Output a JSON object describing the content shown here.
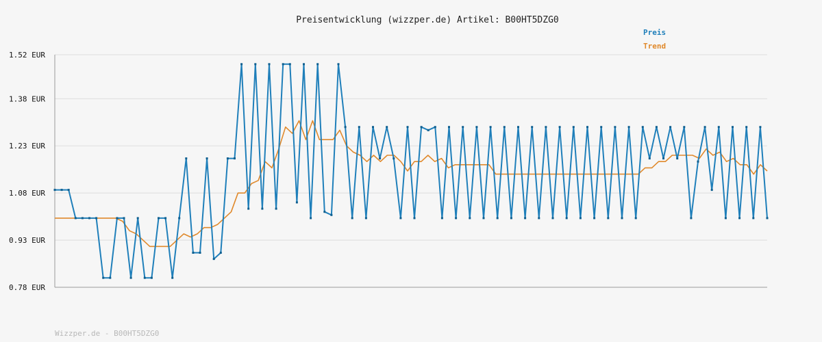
{
  "chart_data": {
    "type": "line",
    "title": "Preisentwicklung (wizzper.de) Artikel: B00HT5DZG0",
    "y_ticks": [
      "1.52 EUR",
      "1.38 EUR",
      "1.23 EUR",
      "1.08 EUR",
      "0.93 EUR",
      "0.78 EUR"
    ],
    "y_tick_values": [
      1.52,
      1.38,
      1.23,
      1.08,
      0.93,
      0.78
    ],
    "ylim": [
      0.78,
      1.52
    ],
    "grid": true,
    "legend_position": "top-right",
    "series": [
      {
        "name": "Preis",
        "color": "#1f7fba",
        "values": [
          1.09,
          1.09,
          1.09,
          1.0,
          1.0,
          1.0,
          1.0,
          0.81,
          0.81,
          1.0,
          1.0,
          0.81,
          1.0,
          0.81,
          0.81,
          1.0,
          1.0,
          0.81,
          1.0,
          1.19,
          0.89,
          0.89,
          1.19,
          0.87,
          0.89,
          1.19,
          1.19,
          1.49,
          1.03,
          1.49,
          1.03,
          1.49,
          1.03,
          1.49,
          1.49,
          1.05,
          1.49,
          1.0,
          1.49,
          1.02,
          1.01,
          1.49,
          1.29,
          1.0,
          1.29,
          1.0,
          1.29,
          1.19,
          1.29,
          1.19,
          1.0,
          1.29,
          1.0,
          1.29,
          1.28,
          1.29,
          1.0,
          1.29,
          1.0,
          1.29,
          1.0,
          1.29,
          1.0,
          1.29,
          1.0,
          1.29,
          1.0,
          1.29,
          1.0,
          1.29,
          1.0,
          1.29,
          1.0,
          1.29,
          1.0,
          1.29,
          1.0,
          1.29,
          1.0,
          1.29,
          1.0,
          1.29,
          1.0,
          1.29,
          1.0,
          1.29,
          1.19,
          1.29,
          1.19,
          1.29,
          1.19,
          1.29,
          1.0,
          1.18,
          1.29,
          1.09,
          1.29,
          1.0,
          1.29,
          1.0,
          1.29,
          1.0,
          1.29,
          1.0
        ]
      },
      {
        "name": "Trend",
        "color": "#e0892b",
        "values": [
          1.0,
          1.0,
          1.0,
          1.0,
          1.0,
          1.0,
          1.0,
          1.0,
          1.0,
          1.0,
          0.99,
          0.96,
          0.95,
          0.93,
          0.91,
          0.91,
          0.91,
          0.91,
          0.93,
          0.95,
          0.94,
          0.95,
          0.97,
          0.97,
          0.98,
          1.0,
          1.02,
          1.08,
          1.08,
          1.11,
          1.12,
          1.18,
          1.16,
          1.22,
          1.29,
          1.27,
          1.31,
          1.25,
          1.31,
          1.25,
          1.25,
          1.25,
          1.28,
          1.23,
          1.21,
          1.2,
          1.18,
          1.2,
          1.18,
          1.2,
          1.2,
          1.18,
          1.15,
          1.18,
          1.18,
          1.2,
          1.18,
          1.19,
          1.16,
          1.17,
          1.17,
          1.17,
          1.17,
          1.17,
          1.17,
          1.14,
          1.14,
          1.14,
          1.14,
          1.14,
          1.14,
          1.14,
          1.14,
          1.14,
          1.14,
          1.14,
          1.14,
          1.14,
          1.14,
          1.14,
          1.14,
          1.14,
          1.14,
          1.14,
          1.14,
          1.14,
          1.14,
          1.16,
          1.16,
          1.18,
          1.18,
          1.2,
          1.2,
          1.2,
          1.2,
          1.19,
          1.22,
          1.2,
          1.21,
          1.18,
          1.19,
          1.17,
          1.17,
          1.14,
          1.17,
          1.15
        ]
      }
    ]
  },
  "footer": "Wizzper.de - B00HT5DZG0"
}
